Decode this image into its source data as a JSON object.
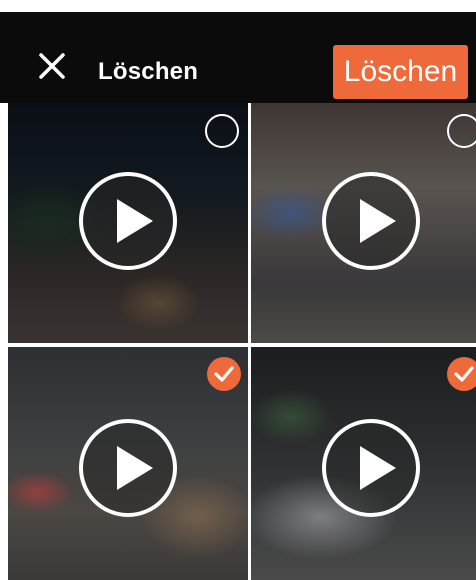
{
  "header": {
    "title": "Löschen",
    "delete_label": "Löschen",
    "close_icon": "close-icon"
  },
  "colors": {
    "accent": "#ee6a3b",
    "header_bg": "#0b0b0b"
  },
  "grid": {
    "items": [
      {
        "type": "video",
        "selected": false
      },
      {
        "type": "video",
        "selected": false
      },
      {
        "type": "video",
        "selected": true
      },
      {
        "type": "video",
        "selected": true
      }
    ]
  }
}
